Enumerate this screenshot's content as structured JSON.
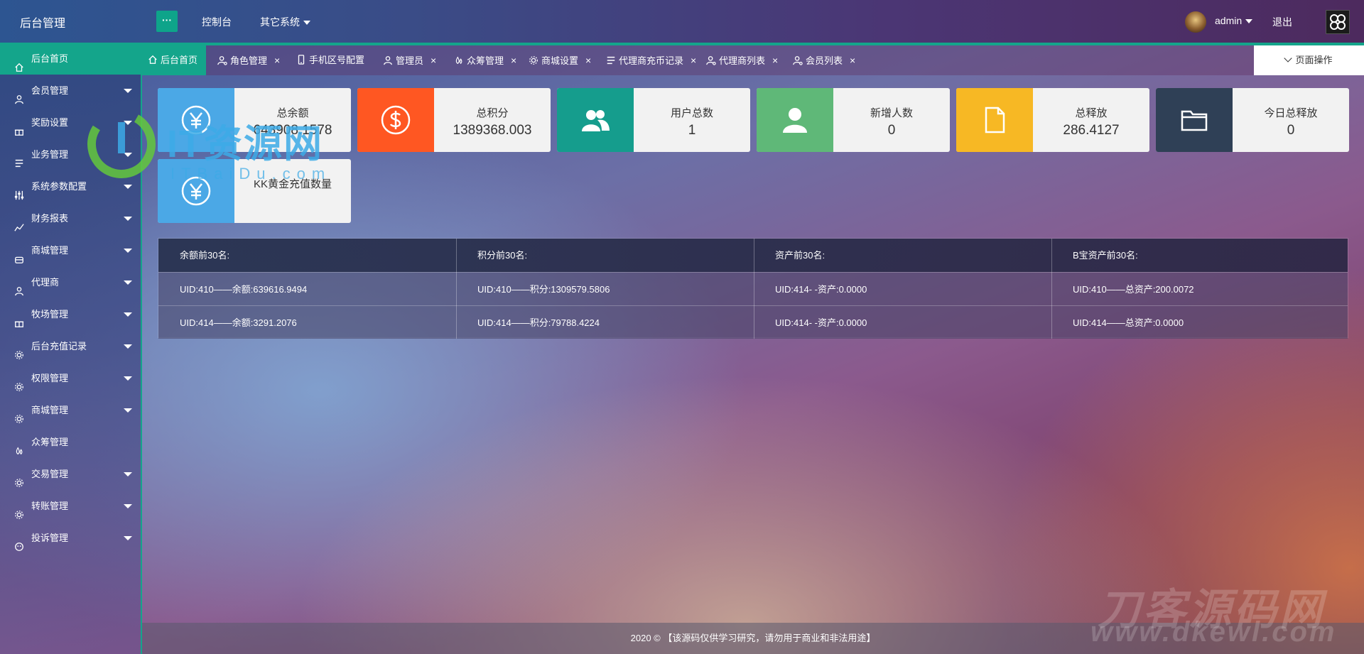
{
  "header": {
    "brand": "后台管理",
    "menu_toggle": "···",
    "nav": [
      {
        "label": "控制台"
      },
      {
        "label": "其它系统"
      }
    ],
    "user": "admin",
    "logout": "退出"
  },
  "sidebar": {
    "items": [
      {
        "label": "后台首页",
        "icon": "home-icon",
        "active": true,
        "arrow": false
      },
      {
        "label": "会员管理",
        "icon": "user-icon",
        "arrow": true
      },
      {
        "label": "奖励设置",
        "icon": "gift-icon",
        "arrow": true
      },
      {
        "label": "业务管理",
        "icon": "list-icon",
        "arrow": true
      },
      {
        "label": "系统参数配置",
        "icon": "sliders-icon",
        "arrow": true
      },
      {
        "label": "财务报表",
        "icon": "chart-icon",
        "arrow": true
      },
      {
        "label": "商城管理",
        "icon": "shop-icon",
        "arrow": true
      },
      {
        "label": "代理商",
        "icon": "user-icon",
        "arrow": true
      },
      {
        "label": "牧场管理",
        "icon": "gift-icon",
        "arrow": true
      },
      {
        "label": "后台充值记录",
        "icon": "gear-icon",
        "arrow": true
      },
      {
        "label": "权限管理",
        "icon": "gear-icon",
        "arrow": true
      },
      {
        "label": "商城管理",
        "icon": "gear-icon",
        "arrow": true
      },
      {
        "label": "众筹管理",
        "icon": "drop-icon",
        "arrow": false
      },
      {
        "label": "交易管理",
        "icon": "gear-icon",
        "arrow": true
      },
      {
        "label": "转账管理",
        "icon": "gear-icon",
        "arrow": true
      },
      {
        "label": "投诉管理",
        "icon": "face-icon",
        "arrow": true
      }
    ]
  },
  "tabs": [
    {
      "label": "后台首页",
      "icon": "home-icon",
      "active": true,
      "closable": false
    },
    {
      "label": "角色管理",
      "icon": "user-gear-icon",
      "closable": true
    },
    {
      "label": "手机区号配置",
      "icon": "mobile-icon",
      "closable": true
    },
    {
      "label": "管理员",
      "icon": "user-icon",
      "closable": true
    },
    {
      "label": "众筹管理",
      "icon": "drop-icon",
      "closable": true
    },
    {
      "label": "商城设置",
      "icon": "gear-icon",
      "closable": true
    },
    {
      "label": "代理商充币记录",
      "icon": "list-icon",
      "closable": true
    },
    {
      "label": "代理商列表",
      "icon": "user-gear-icon",
      "closable": true
    },
    {
      "label": "会员列表",
      "icon": "user-gear-icon",
      "closable": true
    }
  ],
  "tab_close": "×",
  "page_operation": "页面操作",
  "cards": [
    {
      "label": "总余额",
      "value": "643908.1578",
      "icon": "yen-icon",
      "color": "#4ba8e6"
    },
    {
      "label": "总积分",
      "value": "1389368.003",
      "icon": "dollar-icon",
      "color": "#ff5722"
    },
    {
      "label": "用户总数",
      "value": "1",
      "icon": "users-icon",
      "color": "#159d8d"
    },
    {
      "label": "新增人数",
      "value": "0",
      "icon": "user-icon",
      "color": "#5fb878"
    },
    {
      "label": "总释放",
      "value": "286.4127",
      "icon": "file-icon",
      "color": "#f7b824"
    },
    {
      "label": "今日总释放",
      "value": "0",
      "icon": "folder-icon",
      "color": "#2f4056"
    },
    {
      "label": "KK黄金充值数量",
      "value": "",
      "icon": "yen-icon",
      "color": "#4ba8e6"
    }
  ],
  "rank_table": {
    "headers": [
      "余额前30名:",
      "积分前30名:",
      "资产前30名:",
      "B宝资产前30名:"
    ],
    "rows": [
      [
        "UID:410——余额:639616.9494",
        "UID:410——积分:1309579.5806",
        "UID:414- -资产:0.0000",
        "UID:410——总资产:200.0072"
      ],
      [
        "UID:414——余额:3291.2076",
        "UID:414——积分:79788.4224",
        "UID:414- -资产:0.0000",
        "UID:414——总资产:0.0000"
      ]
    ]
  },
  "footer": "2020 © 【该源码仅供学习研究，请勿用于商业和非法用途】",
  "watermarks": {
    "main": "IT资源网",
    "main_sub": "ITBaiDu.com",
    "corner": "刀客源码网",
    "corner_sub": "www.dkewl.com"
  }
}
